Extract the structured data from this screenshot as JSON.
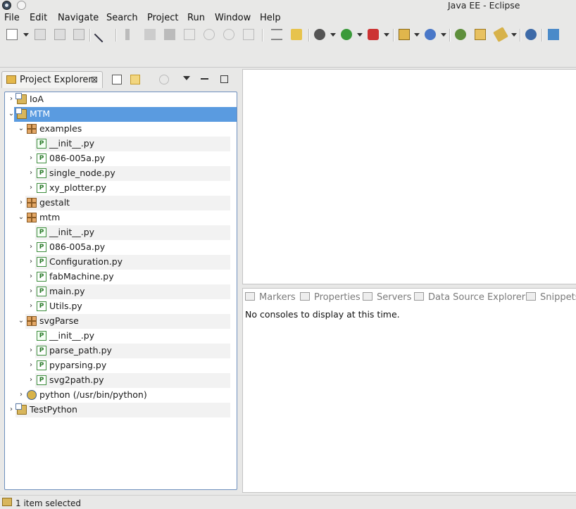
{
  "window": {
    "title": "Java EE - Eclipse"
  },
  "menu": [
    "File",
    "Edit",
    "Navigate",
    "Search",
    "Project",
    "Run",
    "Window",
    "Help"
  ],
  "view": {
    "tab_label": "Project Explorer",
    "close_glyph": "⊠"
  },
  "tree": [
    {
      "label": "IoA",
      "type": "project",
      "depth": 0,
      "arrow": "›"
    },
    {
      "label": "MTM",
      "type": "project",
      "depth": 0,
      "arrow": "⌄",
      "selected": true
    },
    {
      "label": "examples",
      "type": "package",
      "depth": 1,
      "arrow": "⌄"
    },
    {
      "label": "__init__.py",
      "type": "pyfile",
      "depth": 2,
      "arrow": "",
      "init": true
    },
    {
      "label": "086-005a.py",
      "type": "pyfile",
      "depth": 2,
      "arrow": "›"
    },
    {
      "label": "single_node.py",
      "type": "pyfile",
      "depth": 2,
      "arrow": "›"
    },
    {
      "label": "xy_plotter.py",
      "type": "pyfile",
      "depth": 2,
      "arrow": "›"
    },
    {
      "label": "gestalt",
      "type": "package",
      "depth": 1,
      "arrow": "›"
    },
    {
      "label": "mtm",
      "type": "package",
      "depth": 1,
      "arrow": "⌄"
    },
    {
      "label": "__init__.py",
      "type": "pyfile",
      "depth": 2,
      "arrow": "",
      "init": true
    },
    {
      "label": "086-005a.py",
      "type": "pyfile",
      "depth": 2,
      "arrow": "›"
    },
    {
      "label": "Configuration.py",
      "type": "pyfile",
      "depth": 2,
      "arrow": "›"
    },
    {
      "label": "fabMachine.py",
      "type": "pyfile",
      "depth": 2,
      "arrow": "›"
    },
    {
      "label": "main.py",
      "type": "pyfile",
      "depth": 2,
      "arrow": "›"
    },
    {
      "label": "Utils.py",
      "type": "pyfile",
      "depth": 2,
      "arrow": "›"
    },
    {
      "label": "svgParse",
      "type": "package",
      "depth": 1,
      "arrow": "⌄"
    },
    {
      "label": "__init__.py",
      "type": "pyfile",
      "depth": 2,
      "arrow": "",
      "init": true
    },
    {
      "label": "parse_path.py",
      "type": "pyfile",
      "depth": 2,
      "arrow": "›"
    },
    {
      "label": "pyparsing.py",
      "type": "pyfile",
      "depth": 2,
      "arrow": "›"
    },
    {
      "label": "svg2path.py",
      "type": "pyfile",
      "depth": 2,
      "arrow": "›"
    },
    {
      "label": "python  (/usr/bin/python)",
      "type": "python",
      "depth": 1,
      "arrow": "›"
    },
    {
      "label": "TestPython",
      "type": "project",
      "depth": 0,
      "arrow": "›"
    }
  ],
  "bottom_tabs": [
    "Markers",
    "Properties",
    "Servers",
    "Data Source Explorer",
    "Snippets"
  ],
  "console_message": "No consoles to display at this time.",
  "status": "1 item selected",
  "colors": {
    "selection": "#5a9be0",
    "tree_border": "#6d8fbd"
  }
}
